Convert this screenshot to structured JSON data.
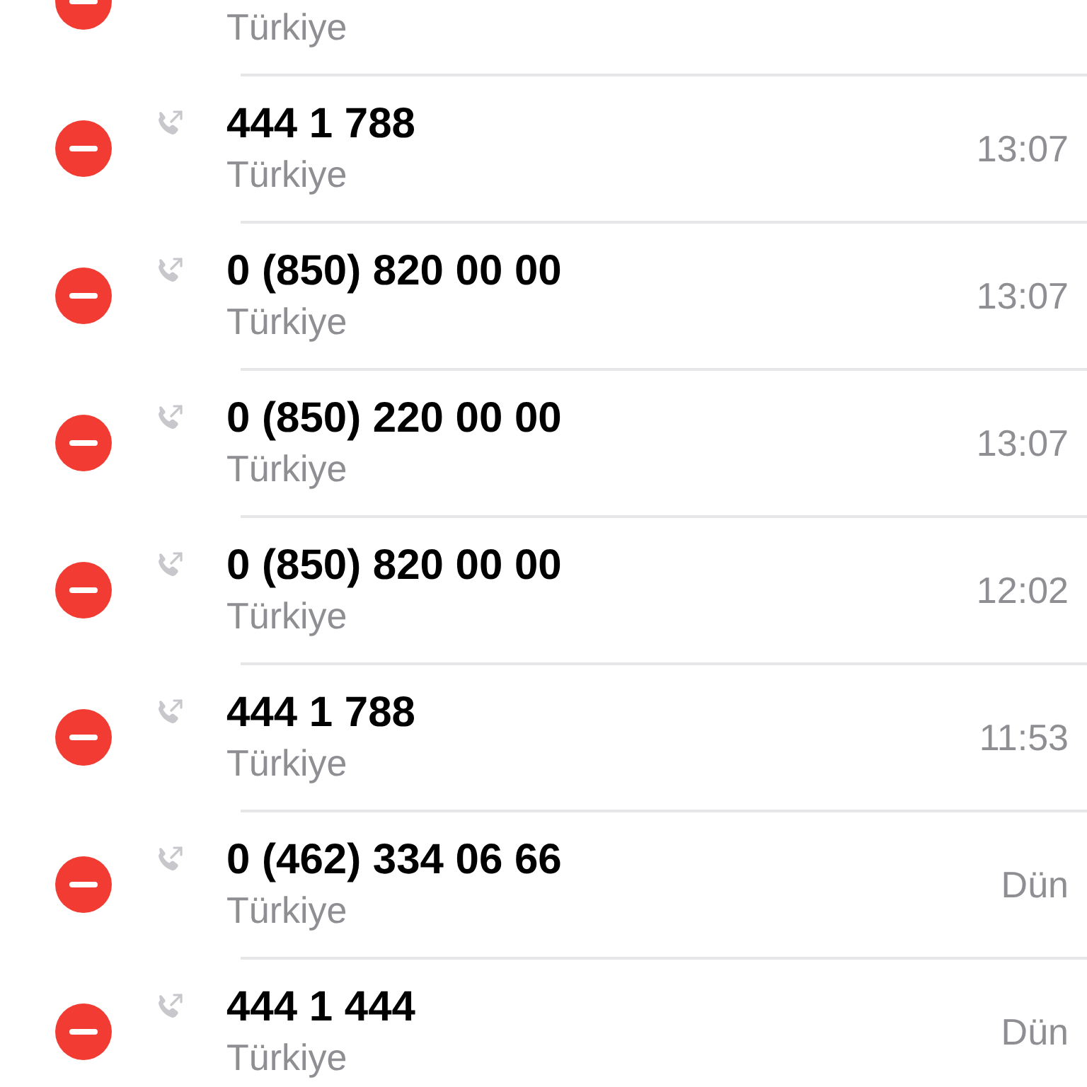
{
  "calls": [
    {
      "subtitle": "Türkiye"
    },
    {
      "number": "444 1 788",
      "subtitle": "Türkiye",
      "time": "13:07"
    },
    {
      "number": "0 (850) 820 00 00",
      "subtitle": "Türkiye",
      "time": "13:07"
    },
    {
      "number": "0 (850) 220 00 00",
      "subtitle": "Türkiye",
      "time": "13:07"
    },
    {
      "number": "0 (850) 820 00 00",
      "subtitle": "Türkiye",
      "time": "12:02"
    },
    {
      "number": "444 1 788",
      "subtitle": "Türkiye",
      "time": "11:53"
    },
    {
      "number": "0 (462) 334 06 66",
      "subtitle": "Türkiye",
      "time": "Dün"
    },
    {
      "number": "444 1 444",
      "subtitle": "Türkiye",
      "time": "Dün"
    }
  ]
}
